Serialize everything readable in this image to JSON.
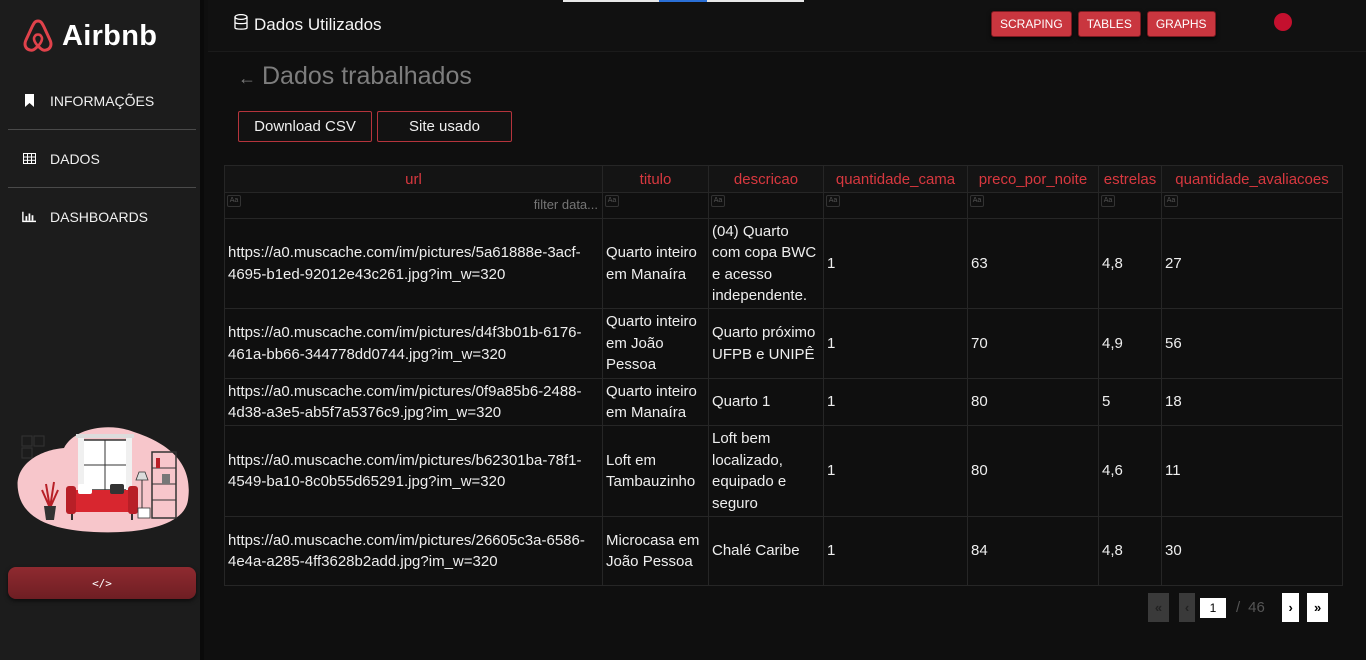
{
  "brand": {
    "name": "Airbnb"
  },
  "sidebar": {
    "items": [
      {
        "label": "INFORMAÇÕES",
        "icon": "bookmark-icon"
      },
      {
        "label": "DADOS",
        "icon": "table-icon"
      },
      {
        "label": "DASHBOARDS",
        "icon": "bar-chart-icon"
      }
    ],
    "code_button": "</>"
  },
  "header": {
    "title": "Dados Utilizados",
    "icon": "database-icon",
    "buttons": [
      "SCRAPING",
      "TABLES",
      "GRAPHS"
    ],
    "status_color": "#c4102e"
  },
  "main": {
    "back_arrow": "←",
    "title": "Dados trabalhados",
    "actions": {
      "download_csv": "Download CSV",
      "site": "Site usado"
    }
  },
  "table": {
    "columns": [
      "url",
      "titulo",
      "descricao",
      "quantidade_cama",
      "preco_por_noite",
      "estrelas",
      "quantidade_avaliacoes"
    ],
    "filter_placeholder": "filter data...",
    "filter_icon": "Aa",
    "rows": [
      [
        "https://a0.muscache.com/im/pictures/5a61888e-3acf-4695-b1ed-92012e43c261.jpg?im_w=320",
        "Quarto inteiro em Manaíra",
        "(04) Quarto com copa BWC e acesso independente.",
        "1",
        "63",
        "4,8",
        "27"
      ],
      [
        "https://a0.muscache.com/im/pictures/d4f3b01b-6176-461a-bb66-344778dd0744.jpg?im_w=320",
        "Quarto inteiro em João Pessoa",
        "Quarto próximo UFPB e UNIPÊ",
        "1",
        "70",
        "4,9",
        "56"
      ],
      [
        "https://a0.muscache.com/im/pictures/0f9a85b6-2488-4d38-a3e5-ab5f7a5376c9.jpg?im_w=320",
        "Quarto inteiro em Manaíra",
        "Quarto 1",
        "1",
        "80",
        "5",
        "18"
      ],
      [
        "https://a0.muscache.com/im/pictures/b62301ba-78f1-4549-ba10-8c0b55d65291.jpg?im_w=320",
        "Loft em Tambauzinho",
        "Loft bem localizado, equipado e seguro",
        "1",
        "80",
        "4,6",
        "11"
      ],
      [
        "https://a0.muscache.com/im/pictures/26605c3a-6586-4e4a-a285-4ff3628b2add.jpg?im_w=320",
        "Microcasa em João Pessoa",
        "Chalé Caribe",
        "1",
        "84",
        "4,8",
        "30"
      ]
    ]
  },
  "pagination": {
    "first": "«",
    "prev": "‹",
    "current": "1",
    "separator": "/",
    "total": "46",
    "next": "›",
    "last": "»"
  },
  "colors": {
    "accent": "#c9363f",
    "column_header": "#d8383f",
    "sidebar_bg": "#1c1c1c"
  }
}
